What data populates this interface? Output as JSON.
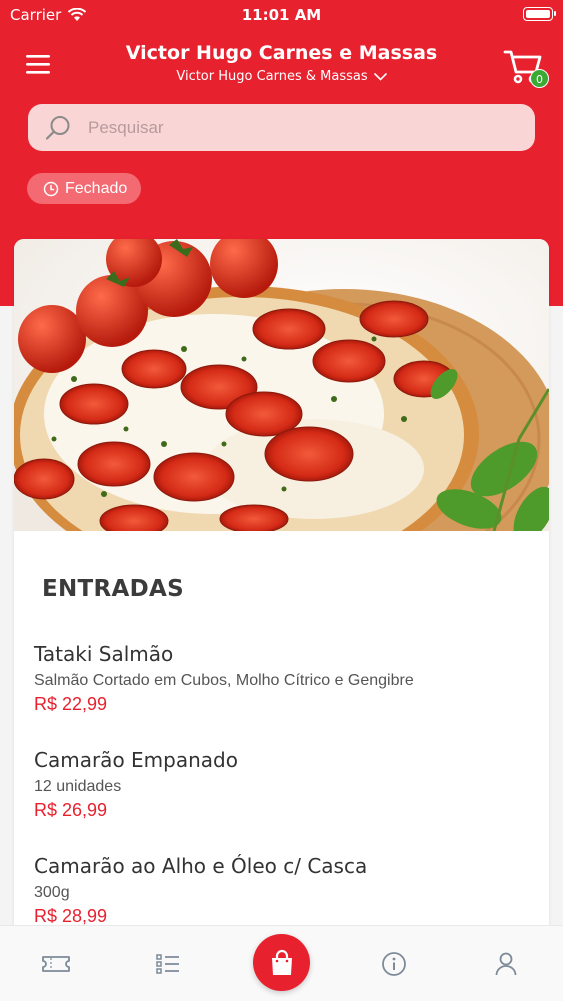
{
  "status_bar": {
    "carrier": "Carrier",
    "time": "11:01 AM"
  },
  "header": {
    "title": "Victor Hugo Carnes e Massas",
    "subtitle": "Victor Hugo Carnes & Massas",
    "cart_count": "0"
  },
  "search": {
    "placeholder": "Pesquisar"
  },
  "store_status": {
    "label": "Fechado"
  },
  "menu": {
    "category": "ENTRADAS",
    "items": [
      {
        "name": "Tataki Salmão",
        "description": "Salmão Cortado em Cubos, Molho Cítrico e Gengibre",
        "price": "R$ 22,99"
      },
      {
        "name": "Camarão Empanado",
        "description": "12 unidades",
        "price": "R$ 26,99"
      },
      {
        "name": "Camarão ao Alho e Óleo c/ Casca",
        "description": "300g",
        "price": "R$ 28,99"
      }
    ]
  },
  "tabbar": {
    "tabs": [
      "ticket-icon",
      "list-icon",
      "bag-icon",
      "info-icon",
      "user-icon"
    ]
  },
  "colors": {
    "brand": "#e8212f",
    "badge": "#3aaa35",
    "pill": "#f36a72"
  }
}
